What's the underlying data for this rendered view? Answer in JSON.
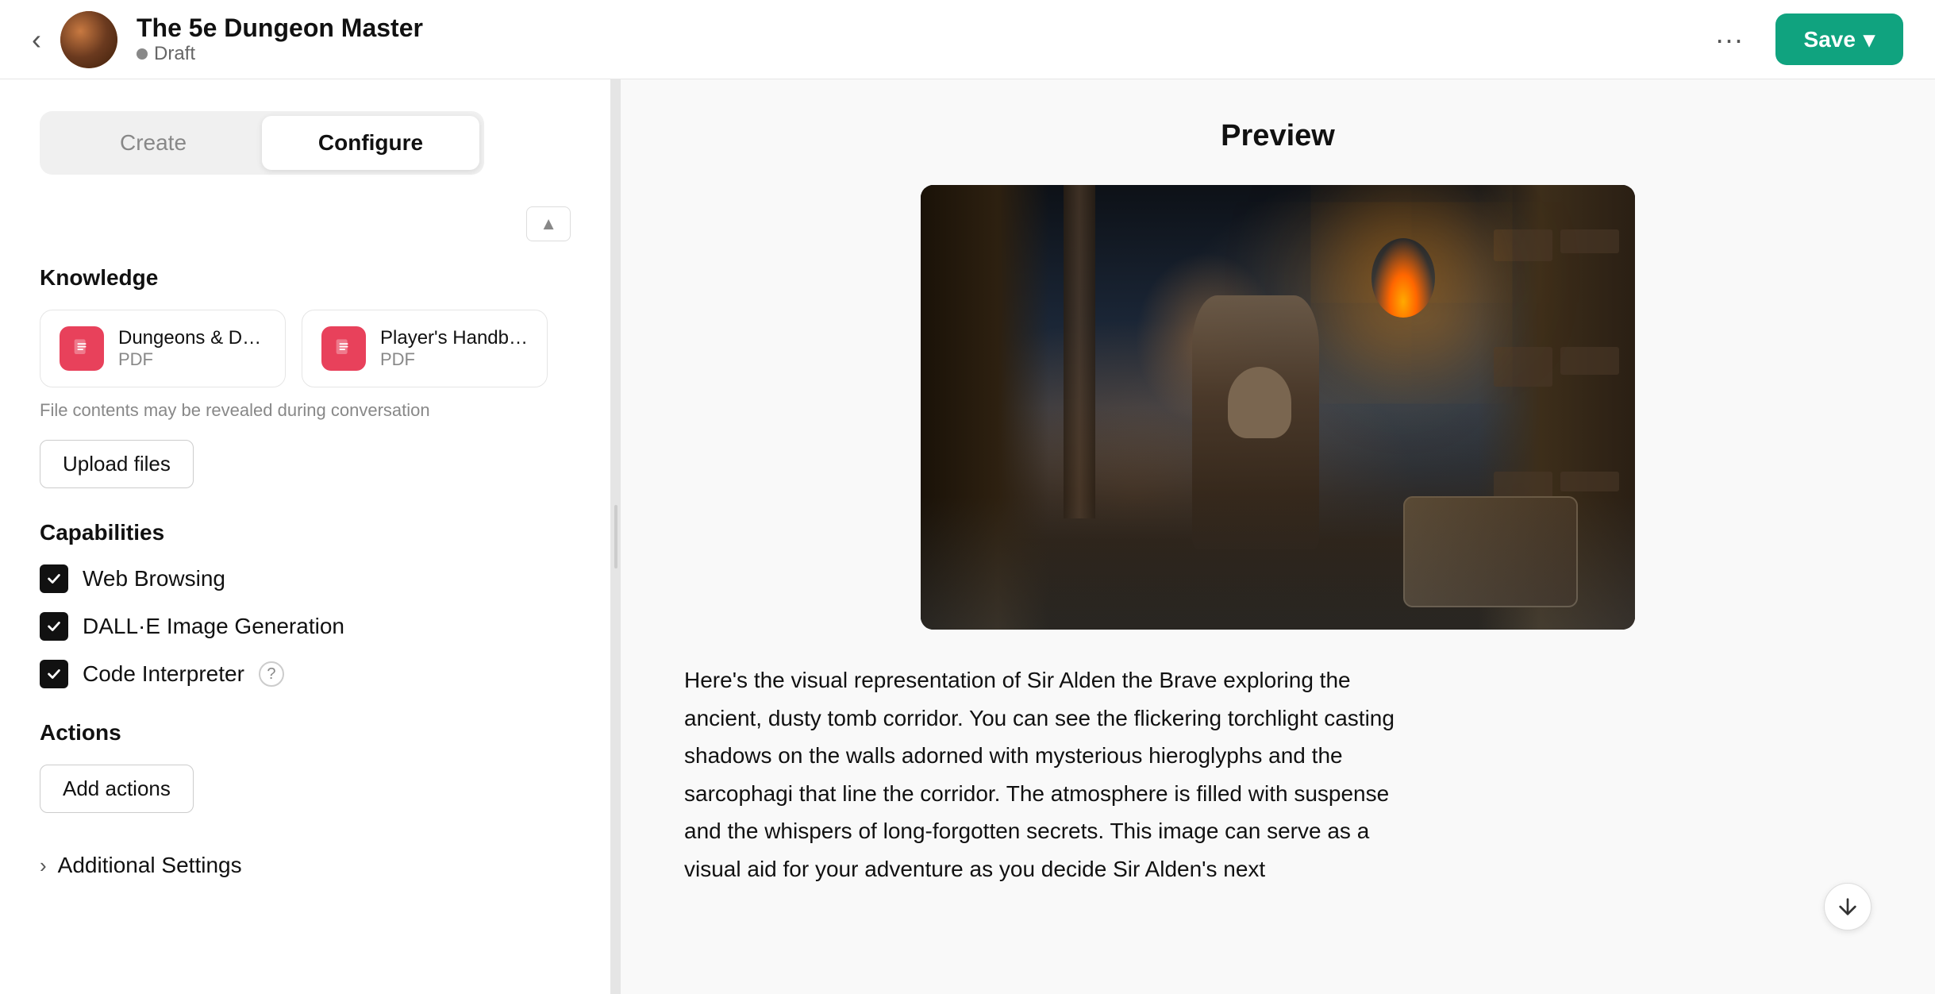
{
  "header": {
    "title": "The 5e Dungeon Master",
    "status": "Draft",
    "back_label": "‹",
    "more_label": "···",
    "save_label": "Save",
    "save_dropdown": "▾"
  },
  "tabs": {
    "create_label": "Create",
    "configure_label": "Configure"
  },
  "knowledge": {
    "section_title": "Knowledge",
    "files": [
      {
        "name": "Dungeons & Dragons Core...",
        "type": "PDF"
      },
      {
        "name": "Player's Handbook 5e.pdf",
        "type": "PDF"
      }
    ],
    "file_note": "File contents may be revealed during conversation",
    "upload_label": "Upload files"
  },
  "capabilities": {
    "section_title": "Capabilities",
    "items": [
      {
        "label": "Web Browsing",
        "checked": true
      },
      {
        "label": "DALL·E Image Generation",
        "checked": true
      },
      {
        "label": "Code Interpreter",
        "checked": true,
        "has_help": true
      }
    ]
  },
  "actions": {
    "section_title": "Actions",
    "add_label": "Add actions"
  },
  "additional_settings": {
    "label": "Additional Settings"
  },
  "preview": {
    "title": "Preview",
    "description": "Here's the visual representation of Sir Alden the Brave exploring the ancient, dusty tomb corridor. You can see the flickering torchlight casting shadows on the walls adorned with mysterious hieroglyphs and the sarcophagi that line the corridor. The atmosphere is filled with suspense and the whispers of long-forgotten secrets. This image can serve as a visual aid for your adventure as you decide Sir Alden's next"
  }
}
